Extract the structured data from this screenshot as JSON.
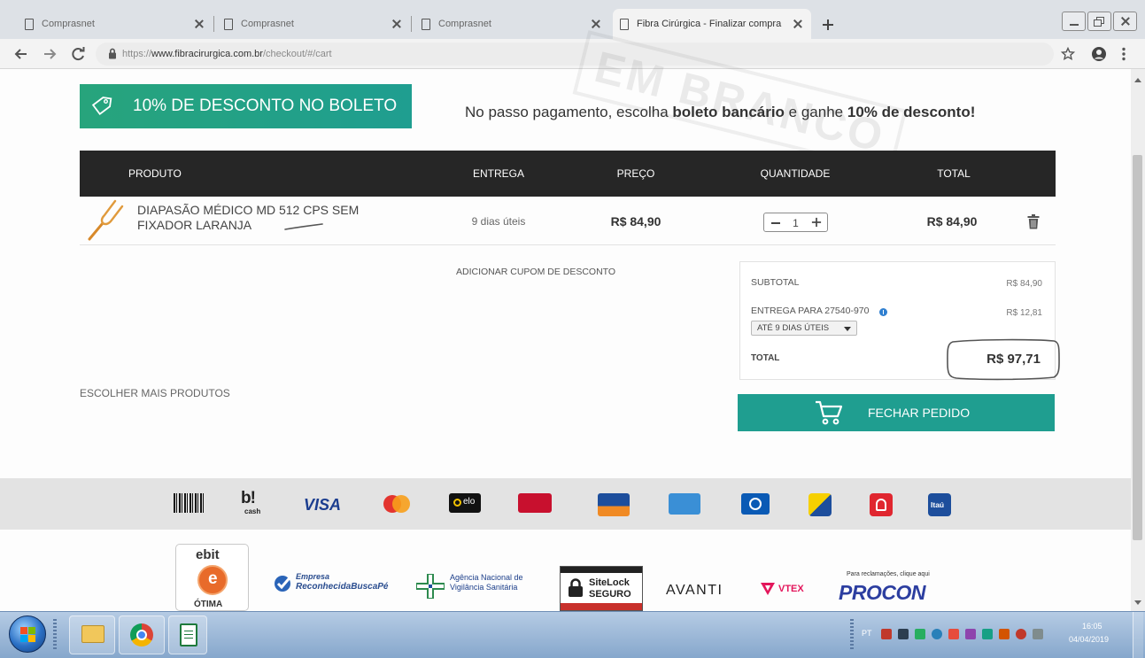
{
  "browser": {
    "tabs": [
      {
        "title": "Comprasnet"
      },
      {
        "title": "Comprasnet"
      },
      {
        "title": "Comprasnet"
      },
      {
        "title": "Fibra Cirúrgica - Finalizar compra",
        "active": true
      }
    ],
    "url": {
      "scheme": "https://",
      "host": "www.fibracirurgica.com.br",
      "path": "/checkout/#/cart"
    },
    "toolbar_icons": [
      "back-arrow-icon",
      "forward-arrow-icon",
      "reload-icon",
      "lock-icon",
      "star-icon",
      "account-icon",
      "menu-icon"
    ]
  },
  "stamp_text": "EM BRANCO",
  "promo": {
    "banner_label": "10% DE DESCONTO NO BOLETO",
    "message_part1": "No passo pagamento, escolha ",
    "message_bold1": "boleto bancário",
    "message_part2": " e ganhe ",
    "message_bold2": "10% de desconto!"
  },
  "cart": {
    "columns": {
      "product": "PRODUTO",
      "delivery": "ENTREGA",
      "price": "PREÇO",
      "quantity": "QUANTIDADE",
      "total": "TOTAL"
    },
    "items": [
      {
        "name": "DIAPASÃO MÉDICO MD 512 CPS SEM FIXADOR LARANJA",
        "delivery": "9 dias úteis",
        "price": "R$ 84,90",
        "quantity": "1",
        "total": "R$ 84,90",
        "image_icon": "tuning-fork-image"
      }
    ],
    "coupon_link": "ADICIONAR CUPOM DE DESCONTO",
    "more_products_link": "ESCOLHER MAIS PRODUTOS"
  },
  "summary": {
    "subtotal_label": "SUBTOTAL",
    "subtotal_value": "R$ 84,90",
    "shipping_label": "ENTREGA PARA 27540-970",
    "shipping_value": "R$ 12,81",
    "shipping_option": "ATÉ 9 DIAS ÚTEIS",
    "total_label": "TOTAL",
    "total_value": "R$ 97,71",
    "checkout_button": "FECHAR PEDIDO"
  },
  "payment_methods": {
    "icons": [
      "boleto-icon",
      "bcash-icon",
      "visa-icon",
      "mastercard-icon",
      "elo-icon",
      "hipercard-icon",
      "aura-icon",
      "amex-icon",
      "diners-icon",
      "bank-icon",
      "santander-icon",
      "itau-icon"
    ],
    "bcash_mark": "b!",
    "bcash_word": "cash",
    "visa": "VISA",
    "elo": "elo",
    "itau": "Itaú"
  },
  "trust_seals": {
    "ebit_logo": "ebit",
    "ebit_mark": "e",
    "ebit_rating": "ÓTIMA",
    "buscape_line1": "Empresa",
    "buscape_line2": "ReconhecidaBuscaPé",
    "anvisa_line1": "Agência Nacional de",
    "anvisa_line2": "Vigilância Sanitária",
    "sitelock_name": "SiteLock",
    "sitelock_status": "SEGURO",
    "avanti": "AVANTI",
    "vtex": "VTEX",
    "procon_note": "Para reclamações, clique aqui",
    "procon": "PROCON"
  },
  "taskbar": {
    "language": "PT",
    "time": "16:05",
    "date": "04/04/2019",
    "pinned": [
      "windows-explorer-icon",
      "chrome-icon",
      "spreadsheet-icon"
    ]
  },
  "colors": {
    "accent": "#1f9e90",
    "banner_start": "#27a47c",
    "table_header": "#262626",
    "text": "#444444"
  }
}
